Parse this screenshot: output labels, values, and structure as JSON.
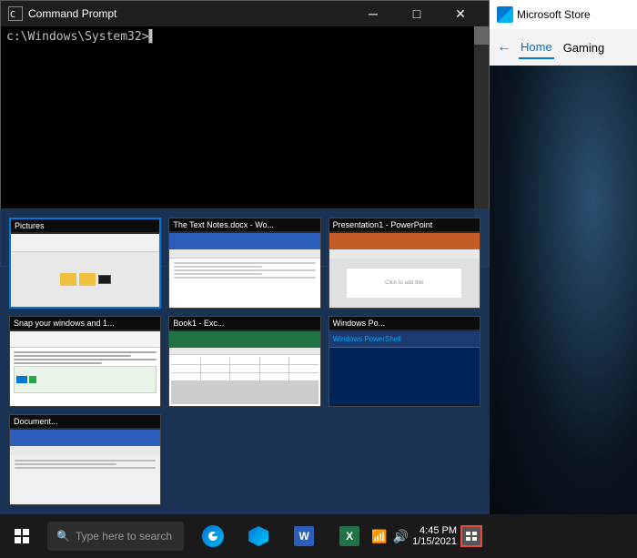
{
  "cmd": {
    "title": "Command Prompt",
    "prompt_text": "c:\\Windows\\System32>",
    "minimize": "─",
    "maximize": "□",
    "close": "✕"
  },
  "ms_store": {
    "title": "Microsoft Store",
    "nav": {
      "back": "←",
      "home": "Home",
      "gaming": "Gaming"
    }
  },
  "taskbar": {
    "search_placeholder": "Type here to search",
    "task_view_label": "Task View"
  },
  "thumbnails": [
    {
      "id": "pictures",
      "title": "Pictures",
      "type": "explorer",
      "active": true
    },
    {
      "id": "word-doc",
      "title": "The Text Notes.docx - Wo...",
      "type": "word",
      "active": false
    },
    {
      "id": "powerpoint",
      "title": "Presentation1 - PowerPoint",
      "type": "powerpoint",
      "active": false
    },
    {
      "id": "edge-snap",
      "title": "Snap your windows and 1...",
      "type": "edge",
      "active": false
    },
    {
      "id": "excel",
      "title": "Book1 - Exc...",
      "type": "excel",
      "active": false
    },
    {
      "id": "powershell",
      "title": "Windows Po...",
      "type": "powershell",
      "active": false
    },
    {
      "id": "document",
      "title": "Document...",
      "type": "word2",
      "active": false
    }
  ],
  "tray": {
    "time": "4:45 PM",
    "date": "1/15/2021"
  },
  "colors": {
    "taskbar_bg": "#1a1a1a",
    "cmd_bg": "#000000",
    "accent": "#0078d4",
    "highlight": "#e74c3c"
  }
}
